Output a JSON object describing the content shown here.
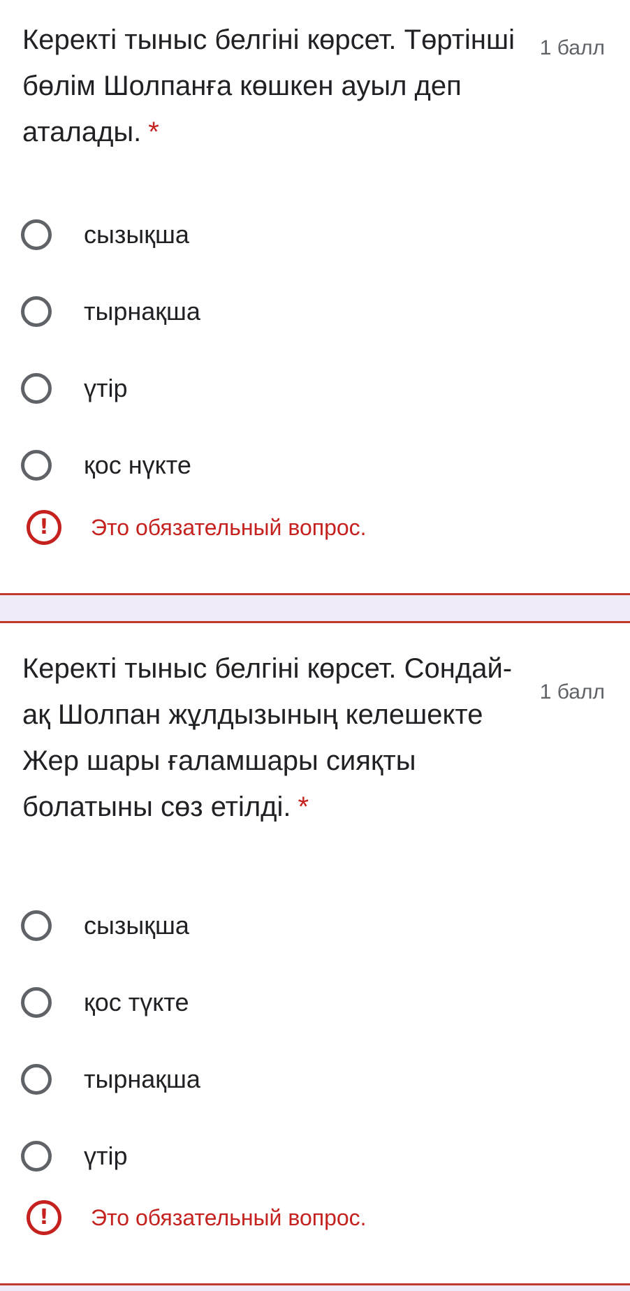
{
  "questions": [
    {
      "title": "Керекті тыныс белгіні көрсет. Төртінші бөлім Шолпанға көшкен ауыл деп аталады.",
      "required_marker": "*",
      "points": "1 балл",
      "options": [
        {
          "label": "сызықша"
        },
        {
          "label": "тырнақша"
        },
        {
          "label": "үтір"
        },
        {
          "label": "қос нүкте"
        }
      ],
      "error": "Это обязательный вопрос.",
      "error_icon": "!"
    },
    {
      "title": "Керекті тыныс белгіні көрсет. Сондай-ақ Шолпан жұлдызының келешекте Жер шары ғаламшары сияқты болатыны сөз етілді.",
      "required_marker": "*",
      "points": "1 балл",
      "options": [
        {
          "label": "сызықша"
        },
        {
          "label": "қос түкте"
        },
        {
          "label": "тырнақша"
        },
        {
          "label": "үтір"
        }
      ],
      "error": "Это обязательный вопрос.",
      "error_icon": "!"
    }
  ],
  "colors": {
    "error": "#c5221f",
    "radio_border": "#5f6368",
    "text": "#202124",
    "secondary_text": "#5f6368",
    "separator": "#efebf8"
  },
  "icons": {
    "radio": "radio-unchecked-icon",
    "error": "exclamation-circle-icon"
  }
}
